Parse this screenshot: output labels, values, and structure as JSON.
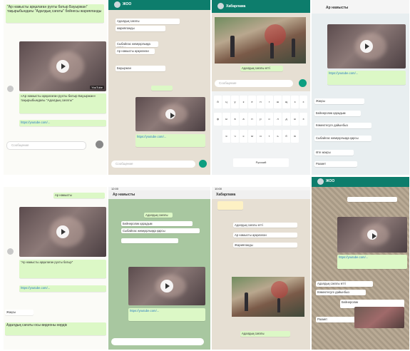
{
  "shots": {
    "s1": {
      "msg_text": "\"Ар намысты арқалаған рухты батыр Бауыржан\" тақырыбындағы \"Адалдық сағаты\" бейнесы жарияланды",
      "video_caption": "«Ар намысты арқалаған рухты батыр Бауыржан» тақырыбындағы \"Адалдық сағаты\"",
      "link": "https://youtube.com/...",
      "input_placeholder": "Сообщение",
      "yt_label": "YouTube"
    },
    "s2": {
      "title": "ЖОО",
      "items": [
        "Адалдық сағаты",
        "жарияланды",
        "Сыбайлас жемқорлыққа қарсы",
        "Ар намысты арқалаған",
        "Бауыржан"
      ],
      "link": "https://youtube.com/...",
      "input_placeholder": "Сообщение"
    },
    "s3": {
      "title": "Хабарлама",
      "caption": "Адалдық сағаты өтті",
      "input_placeholder": "Сообщение",
      "keys_row1": [
        "й",
        "ц",
        "у",
        "к",
        "е",
        "н",
        "г",
        "ш",
        "щ",
        "з",
        "х"
      ],
      "keys_row2": [
        "ф",
        "ы",
        "в",
        "а",
        "п",
        "р",
        "о",
        "л",
        "д",
        "ж",
        "э"
      ],
      "keys_row3": [
        "я",
        "ч",
        "с",
        "м",
        "и",
        "т",
        "ь",
        "б",
        "ю"
      ],
      "space_label": "Русский"
    },
    "s4": {
      "title": "Ар намысты",
      "items": [
        "Жақсы",
        "Бейнеролик қарадым",
        "Көмектесуге дайынбыз",
        "Сыбайлас жемқорлыққа қарсы",
        "Өте жақсы",
        "Рахмет"
      ],
      "link": "https://youtube.com/..."
    },
    "s5": {
      "header": "Ар намысты",
      "msg_text": "\"Ар намысты арқалаған рухты батыр\"",
      "link": "https://youtube.com/...",
      "reply1": "Жақсы",
      "reply2": "Адалдық сағаты осы видеоны көрдік"
    },
    "s6": {
      "time": "12:00",
      "title": "Ар намысты",
      "items": [
        "Адалдық сағаты",
        "Бейнеролик қарадым",
        "Сыбайлас жемқорлыққа қарсы"
      ],
      "link": "https://youtube.com/..."
    },
    "s7": {
      "time": "10:00",
      "title": "Хабарлама",
      "items": [
        "Адалдық сағаты өтті",
        "Ар намысты арқалаған",
        "Жарияланды"
      ],
      "caption": "Адалдық сағаты"
    },
    "s8": {
      "title": "ЖОО",
      "items": [
        "Адалдық сағаты өтті",
        "Көмектесуге дайынбыз",
        "Бейнеролик",
        "Рахмет"
      ],
      "link": "https://youtube.com/..."
    }
  },
  "colors": {
    "header_green": "#0d7d6c",
    "bubble_out": "#dcf8c6",
    "bubble_in": "#ffffff",
    "link": "#2a7dc0",
    "send_button": "#0d9e80"
  },
  "icons": [
    "play-icon",
    "mic-icon",
    "send-icon"
  ]
}
